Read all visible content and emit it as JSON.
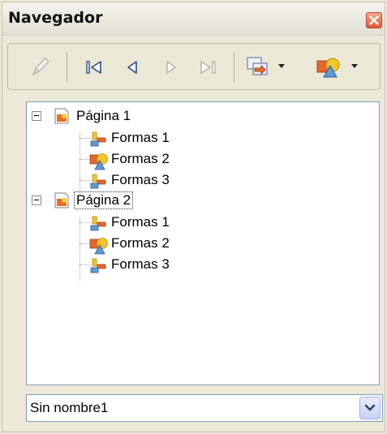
{
  "window": {
    "title": "Navegador"
  },
  "toolbar": {
    "items": [
      {
        "icon": "pencil-icon",
        "enabled": false
      },
      {
        "icon": "first-page-icon",
        "enabled": true
      },
      {
        "icon": "previous-page-icon",
        "enabled": true
      },
      {
        "icon": "next-page-icon",
        "enabled": false
      },
      {
        "icon": "last-page-icon",
        "enabled": false
      },
      {
        "icon": "drag-mode-icon",
        "enabled": true
      },
      {
        "icon": "shapes-icon",
        "enabled": true
      }
    ]
  },
  "tree": {
    "pages": [
      {
        "label": "Página 1",
        "expanded": true,
        "selected": false,
        "children": [
          {
            "label": "Formas 1",
            "icon": "bar-shape-icon"
          },
          {
            "label": "Formas 2",
            "icon": "shapes-icon"
          },
          {
            "label": "Formas 3",
            "icon": "bar-shape-icon"
          }
        ]
      },
      {
        "label": "Página 2",
        "expanded": true,
        "selected": true,
        "children": [
          {
            "label": "Formas 1",
            "icon": "bar-shape-icon"
          },
          {
            "label": "Formas 2",
            "icon": "shapes-icon"
          },
          {
            "label": "Formas 3",
            "icon": "bar-shape-icon"
          }
        ]
      }
    ]
  },
  "document_select": {
    "value": "Sin nombre1"
  }
}
